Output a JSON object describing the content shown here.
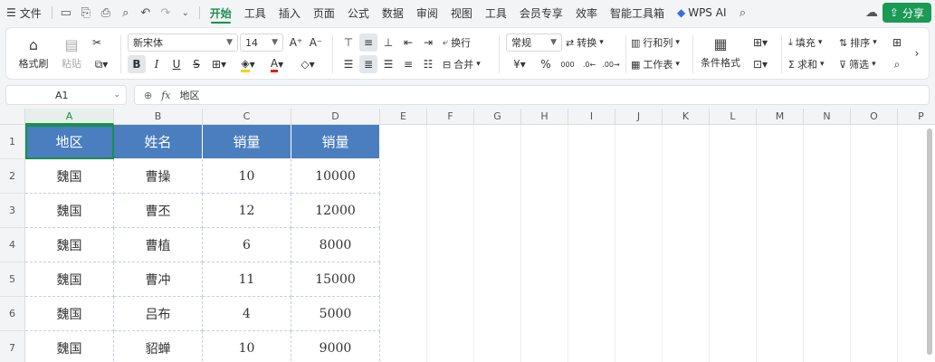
{
  "menubar": {
    "hamburger": "☰",
    "file": "文件",
    "tabs": [
      "开始",
      "工具",
      "插入",
      "页面",
      "公式",
      "数据",
      "审阅",
      "视图",
      "工具",
      "会员专享",
      "效率",
      "智能工具箱"
    ],
    "wps_ai": "WPS AI",
    "share": "分享"
  },
  "ribbon": {
    "format_painter": "格式刷",
    "paste": "粘贴",
    "font_name": "新宋体",
    "font_size": "14",
    "wrap": "换行",
    "merge": "合并",
    "number_format": "常规",
    "convert": "转换",
    "rows_cols": "行和列",
    "worksheet": "工作表",
    "cond_format": "条件格式",
    "fill": "填充",
    "sort": "排序",
    "sum": "求和",
    "filter": "筛选",
    "bold": "B",
    "italic": "I",
    "underline": "U",
    "currency": "¥",
    "percent": "%"
  },
  "formula_bar": {
    "cell_ref": "A1",
    "fx": "fx",
    "content": "地区"
  },
  "columns": [
    "A",
    "B",
    "C",
    "D",
    "E",
    "F",
    "G",
    "H",
    "I",
    "J",
    "K",
    "L",
    "M",
    "N",
    "O",
    "P"
  ],
  "rows": [
    "1",
    "2",
    "3",
    "4",
    "5",
    "6",
    "7"
  ],
  "table": {
    "headers": [
      "地区",
      "姓名",
      "销量",
      "销量"
    ],
    "data": [
      [
        "魏国",
        "曹操",
        "10",
        "10000"
      ],
      [
        "魏国",
        "曹丕",
        "12",
        "12000"
      ],
      [
        "魏国",
        "曹植",
        "6",
        "8000"
      ],
      [
        "魏国",
        "曹冲",
        "11",
        "15000"
      ],
      [
        "魏国",
        "吕布",
        "4",
        "5000"
      ],
      [
        "魏国",
        "貂蝉",
        "10",
        "9000"
      ]
    ]
  },
  "colors": {
    "accent": "#1a8f4e",
    "header_fill": "#4a7ebf"
  }
}
